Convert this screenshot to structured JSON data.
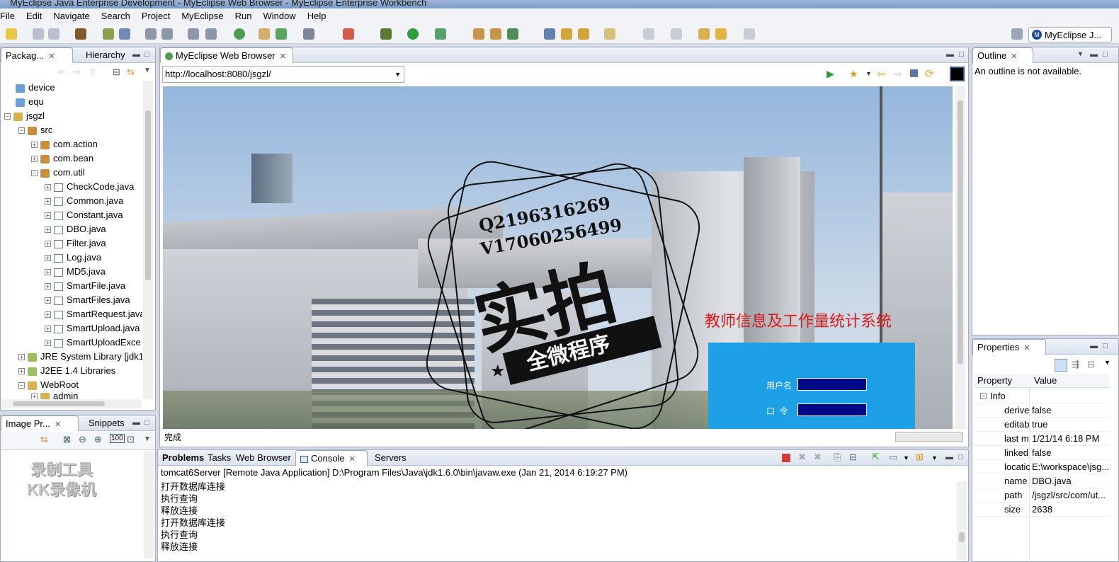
{
  "window": {
    "title": "MyEclipse Java Enterprise Development - MyEclipse Web Browser - MyEclipse Enterprise Workbench"
  },
  "menu": [
    "File",
    "Edit",
    "Navigate",
    "Search",
    "Project",
    "MyEclipse",
    "Run",
    "Window",
    "Help"
  ],
  "perspective": {
    "label": "MyEclipse J..."
  },
  "package_explorer": {
    "tabs": [
      {
        "label": "Packag..."
      },
      {
        "label": "Hierarchy"
      }
    ],
    "items": [
      {
        "label": "device"
      },
      {
        "label": "equ"
      },
      {
        "label": "jsgzl"
      },
      {
        "label": "src"
      },
      {
        "label": "com.action"
      },
      {
        "label": "com.bean"
      },
      {
        "label": "com.util"
      },
      {
        "label": "CheckCode.java"
      },
      {
        "label": "Common.java"
      },
      {
        "label": "Constant.java"
      },
      {
        "label": "DBO.java"
      },
      {
        "label": "Filter.java"
      },
      {
        "label": "Log.java"
      },
      {
        "label": "MD5.java"
      },
      {
        "label": "SmartFile.java"
      },
      {
        "label": "SmartFiles.java"
      },
      {
        "label": "SmartRequest.java"
      },
      {
        "label": "SmartUpload.java"
      },
      {
        "label": "SmartUploadExce"
      },
      {
        "label": "JRE System Library [jdk1"
      },
      {
        "label": "J2EE 1.4 Libraries"
      },
      {
        "label": "WebRoot"
      },
      {
        "label": "admin"
      }
    ]
  },
  "image_preview": {
    "tabs": [
      {
        "label": "Image Pr..."
      },
      {
        "label": "Snippets"
      }
    ],
    "watermark_lines": [
      "录制工具",
      "KK录像机"
    ]
  },
  "browser": {
    "tab": "MyEclipse Web Browser",
    "url": "http://localhost:8080/jsgzl/",
    "status": "完成",
    "page": {
      "stamp_line1": "Q2196316269",
      "stamp_line2": "V17060256499",
      "stamp_big": "实拍",
      "stamp_banner": "全微程序",
      "system_title": "教师信息及工作量统计系统",
      "username_label": "用户名",
      "password_label": "口  令"
    }
  },
  "outline": {
    "tab": "Outline",
    "message": "An outline is not available."
  },
  "properties": {
    "tab": "Properties",
    "headers": {
      "property": "Property",
      "value": "Value"
    },
    "group": "Info",
    "rows": [
      {
        "key": "derive",
        "value": "false"
      },
      {
        "key": "editab",
        "value": "true"
      },
      {
        "key": "last m",
        "value": "1/21/14 6:18 PM"
      },
      {
        "key": "linked",
        "value": "false"
      },
      {
        "key": "locatic",
        "value": "E:\\workspace\\jsg..."
      },
      {
        "key": "name",
        "value": "DBO.java"
      },
      {
        "key": "path",
        "value": "/jsgzl/src/com/ut..."
      },
      {
        "key": "size",
        "value": "2638"
      }
    ]
  },
  "bottom": {
    "tabs": [
      {
        "label": "Problems"
      },
      {
        "label": "Tasks"
      },
      {
        "label": "Web Browser"
      },
      {
        "label": "Console"
      },
      {
        "label": "Servers"
      }
    ],
    "console_header": "tomcat6Server [Remote Java Application] D:\\Program Files\\Java\\jdk1.6.0\\bin\\javaw.exe (Jan 21, 2014 6:19:27 PM)",
    "lines": [
      "打开数据库连接",
      "执行查询",
      "释放连接",
      "打开数据库连接",
      "执行查询",
      "释放连接"
    ]
  }
}
